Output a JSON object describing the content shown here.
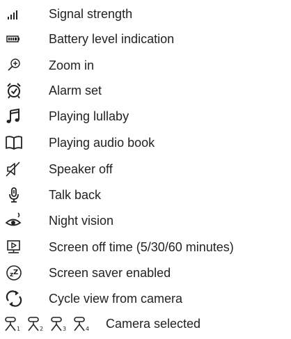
{
  "legend": {
    "items": [
      {
        "icon": "signal-strength-icon",
        "label": "Signal strength"
      },
      {
        "icon": "battery-icon",
        "label": "Battery level indication"
      },
      {
        "icon": "zoom-in-icon",
        "label": "Zoom in"
      },
      {
        "icon": "alarm-clock-icon",
        "label": "Alarm set"
      },
      {
        "icon": "music-note-icon",
        "label": "Playing lullaby"
      },
      {
        "icon": "open-book-icon",
        "label": "Playing audio book"
      },
      {
        "icon": "speaker-off-icon",
        "label": "Speaker off"
      },
      {
        "icon": "microphone-icon",
        "label": "Talk back"
      },
      {
        "icon": "night-vision-eye-icon",
        "label": "Night vision"
      },
      {
        "icon": "screen-off-timer-icon",
        "label": "Screen off time (5/30/60 minutes)"
      },
      {
        "icon": "screen-saver-icon",
        "label": "Screen saver enabled"
      },
      {
        "icon": "cycle-arrows-icon",
        "label": "Cycle view from camera"
      }
    ],
    "camera": {
      "icons": [
        "camera-1-icon",
        "camera-2-icon",
        "camera-3-icon",
        "camera-4-icon"
      ],
      "numbers": [
        "1",
        "2",
        "3",
        "4"
      ],
      "label": "Camera selected"
    }
  }
}
